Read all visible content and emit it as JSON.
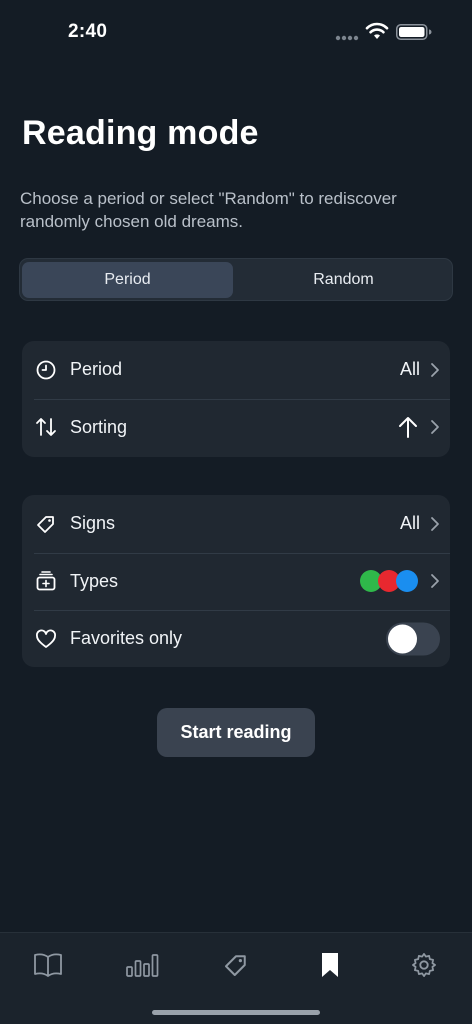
{
  "status_bar": {
    "time": "2:40"
  },
  "header": {
    "title": "Reading mode",
    "subtitle": "Choose a period or select \"Random\" to rediscover randomly chosen old dreams."
  },
  "segmented": {
    "options": [
      "Period",
      "Random"
    ],
    "selected": "Period"
  },
  "filters": {
    "period": {
      "label": "Period",
      "value": "All",
      "icon": "clock-icon"
    },
    "sorting": {
      "label": "Sorting",
      "value_icon": "arrow-up-icon",
      "icon": "sort-arrows-icon"
    },
    "signs": {
      "label": "Signs",
      "value": "All",
      "icon": "tag-icon"
    },
    "types": {
      "label": "Types",
      "icon": "types-icon",
      "colors": [
        "#2fb84a",
        "#e8282f",
        "#1a8ef0"
      ]
    },
    "favorites": {
      "label": "Favorites only",
      "icon": "heart-icon",
      "enabled": false
    }
  },
  "actions": {
    "start": "Start reading"
  },
  "tab_bar": {
    "tabs": [
      "book-icon",
      "stats-icon",
      "tag-icon",
      "bookmark-icon",
      "gear-icon"
    ],
    "active": "bookmark-icon"
  }
}
